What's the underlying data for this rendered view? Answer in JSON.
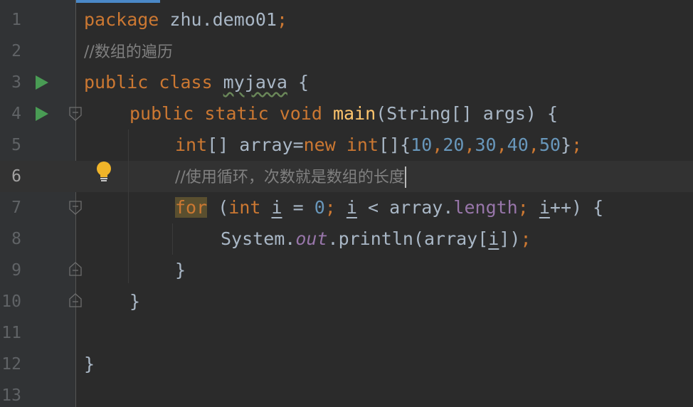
{
  "editor": {
    "line_numbers": [
      "1",
      "2",
      "3",
      "4",
      "5",
      "6",
      "7",
      "8",
      "9",
      "10",
      "11",
      "12",
      "13"
    ],
    "current_line_index": 5,
    "line1": {
      "kw_package": "package",
      "pkg_name": " zhu.demo01",
      "semi": ";"
    },
    "line2": {
      "comment": "//数组的遍历"
    },
    "line3": {
      "kw_public": "public",
      "kw_class": " class ",
      "class_name": "myjava",
      "brace": " {"
    },
    "line4": {
      "kw_public_static_void": "public static void ",
      "method_name": "main",
      "params": "(String[] args) {"
    },
    "line5": {
      "kw_int1": "int",
      "mid1": "[] array=",
      "kw_new": "new",
      "sp": " ",
      "kw_int2": "int",
      "mid2": "[]{",
      "n1": "10",
      "c1": ",",
      "n2": "20",
      "c2": ",",
      "n3": "30",
      "c3": ",",
      "n4": "40",
      "c4": ",",
      "n5": "50",
      "end_brace": "}",
      "semi": ";"
    },
    "line6": {
      "comment": "//使用循环，次数就是数组的长度"
    },
    "line7": {
      "kw_for": "for",
      "open": " (",
      "kw_int": "int",
      "sp1": " ",
      "var_i1": "i",
      "eq": " = ",
      "zero": "0",
      "semi1": ";",
      "sp2": " ",
      "var_i2": "i",
      "lt": " < array.",
      "length": "length",
      "semi2": ";",
      "sp3": " ",
      "var_i3": "i",
      "inc": "++) {"
    },
    "line8": {
      "system": "System.",
      "out": "out",
      "println": ".println(array[",
      "var_i": "i",
      "close": "])",
      "semi": ";"
    },
    "line9": {
      "brace": "}"
    },
    "line10": {
      "brace": "}"
    },
    "line12": {
      "brace": "}"
    }
  },
  "colors": {
    "background": "#2b2b2b",
    "keyword": "#cc7832",
    "number": "#6897bb",
    "comment": "#808080",
    "method": "#ffc66d",
    "field": "#9876aa",
    "run_icon": "#499c54",
    "bulb": "#f0b429"
  },
  "icons": {
    "run": "run-icon",
    "fold": "fold-icon",
    "bulb": "intention-bulb-icon"
  }
}
